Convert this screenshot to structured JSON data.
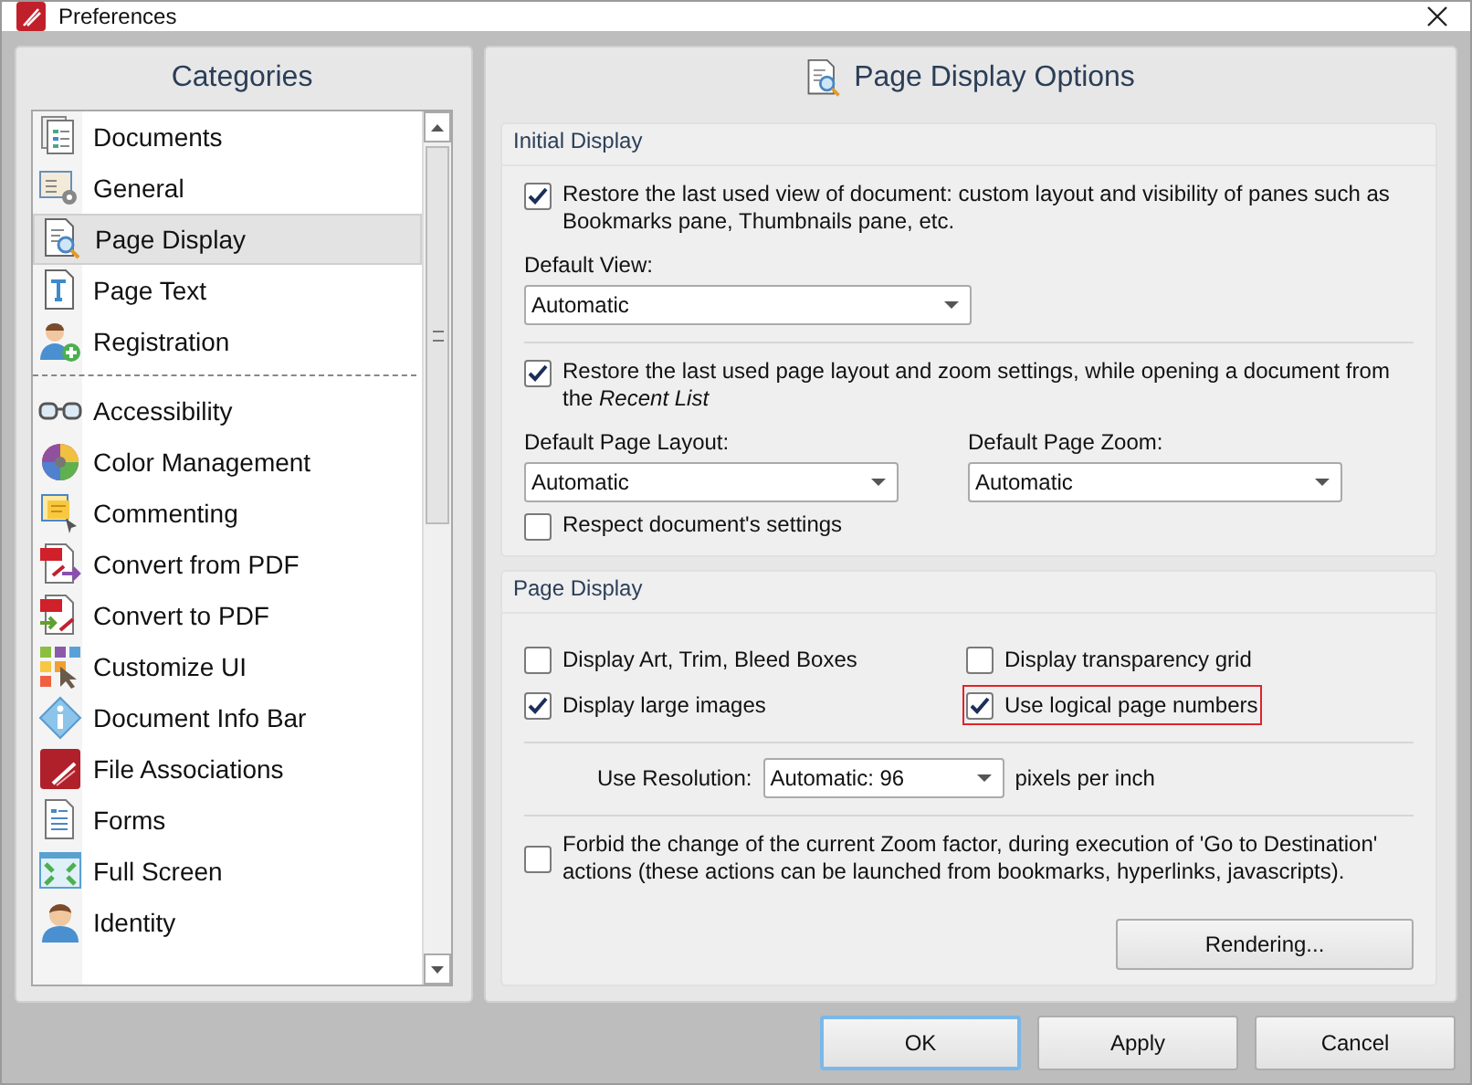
{
  "window": {
    "title": "Preferences"
  },
  "categories": {
    "title": "Categories",
    "groups": [
      [
        {
          "label": "Documents",
          "kind": "documents",
          "selected": false
        },
        {
          "label": "General",
          "kind": "general",
          "selected": false
        },
        {
          "label": "Page Display",
          "kind": "page-display",
          "selected": true
        },
        {
          "label": "Page Text",
          "kind": "page-text",
          "selected": false
        },
        {
          "label": "Registration",
          "kind": "registration",
          "selected": false
        }
      ],
      [
        {
          "label": "Accessibility",
          "kind": "accessibility",
          "selected": false
        },
        {
          "label": "Color Management",
          "kind": "color",
          "selected": false
        },
        {
          "label": "Commenting",
          "kind": "commenting",
          "selected": false
        },
        {
          "label": "Convert from PDF",
          "kind": "convert-from",
          "selected": false
        },
        {
          "label": "Convert to PDF",
          "kind": "convert-to",
          "selected": false
        },
        {
          "label": "Customize UI",
          "kind": "customize",
          "selected": false
        },
        {
          "label": "Document Info Bar",
          "kind": "info",
          "selected": false
        },
        {
          "label": "File Associations",
          "kind": "file-assoc",
          "selected": false
        },
        {
          "label": "Forms",
          "kind": "forms",
          "selected": false
        },
        {
          "label": "Full Screen",
          "kind": "full-screen",
          "selected": false
        },
        {
          "label": "Identity",
          "kind": "identity",
          "selected": false
        }
      ]
    ]
  },
  "options": {
    "title": "Page Display Options",
    "initial_display": {
      "title": "Initial Display",
      "restore_view": {
        "label": "Restore the last used view of document: custom layout and visibility of panes such as Bookmarks pane, Thumbnails pane, etc.",
        "checked": true
      },
      "default_view": {
        "label": "Default View:",
        "value": "Automatic"
      },
      "restore_layout": {
        "label": "Restore the last used page layout and zoom settings, while opening a document from the *Recent List*",
        "checked": true
      },
      "default_page_layout": {
        "label": "Default Page Layout:",
        "value": "Automatic"
      },
      "default_page_zoom": {
        "label": "Default Page Zoom:",
        "value": "Automatic"
      },
      "respect_settings": {
        "label": "Respect document's settings",
        "checked": false
      }
    },
    "page_display": {
      "title": "Page Display",
      "checkboxes": [
        {
          "label": "Display Art, Trim, Bleed Boxes",
          "checked": false,
          "highlighted": false
        },
        {
          "label": "Display transparency grid",
          "checked": false,
          "highlighted": false
        },
        {
          "label": "Display large images",
          "checked": true,
          "highlighted": false
        },
        {
          "label": "Use logical page numbers",
          "checked": true,
          "highlighted": true
        }
      ],
      "resolution": {
        "label": "Use Resolution:",
        "value": "Automatic: 96",
        "unit": "pixels per inch"
      },
      "forbid_zoom": {
        "label": "Forbid the change of the current Zoom factor, during execution of 'Go to Destination' actions (these actions can be launched from bookmarks, hyperlinks, javascripts).",
        "checked": false
      },
      "rendering_button": "Rendering..."
    }
  },
  "buttons": [
    {
      "label": "OK",
      "default": true
    },
    {
      "label": "Apply",
      "default": false
    },
    {
      "label": "Cancel",
      "default": false
    }
  ]
}
